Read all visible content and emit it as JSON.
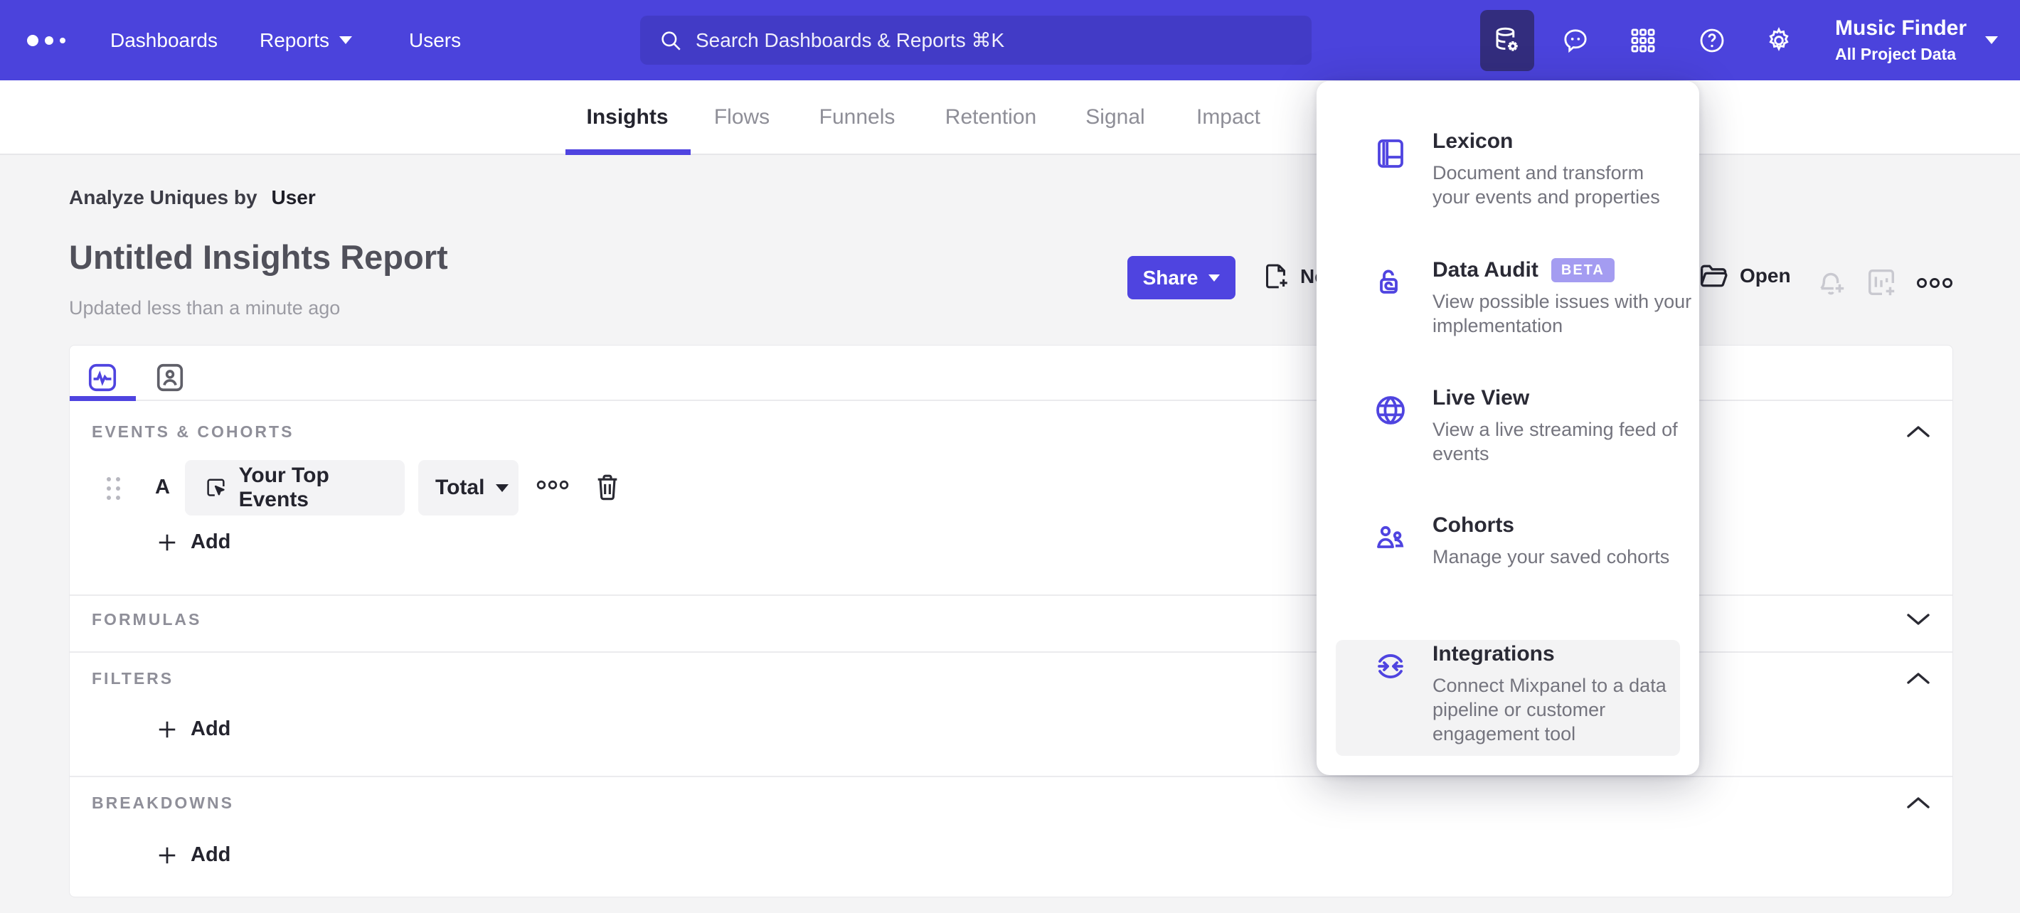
{
  "nav": {
    "items": [
      {
        "label": "Dashboards"
      },
      {
        "label": "Reports"
      },
      {
        "label": "Users"
      }
    ],
    "search_placeholder": "Search Dashboards & Reports ⌘K",
    "project": {
      "name": "Music Finder",
      "scope": "All Project Data"
    }
  },
  "tabs": {
    "items": [
      {
        "label": "Insights"
      },
      {
        "label": "Flows"
      },
      {
        "label": "Funnels"
      },
      {
        "label": "Retention"
      },
      {
        "label": "Signal"
      },
      {
        "label": "Impact"
      }
    ],
    "active": "Insights"
  },
  "report": {
    "analyze_prefix": "Analyze Uniques by",
    "analyze_value": "User",
    "title": "Untitled Insights Report",
    "updated": "Updated less than a minute ago",
    "actions": {
      "share": "Share",
      "new_partial": "Ne",
      "open": "Open"
    }
  },
  "builder": {
    "events": {
      "label": "EVENTS & COHORTS",
      "row_letter": "A",
      "event_name": "Your Top Events",
      "metric": "Total",
      "add_label": "Add"
    },
    "formulas": {
      "label": "FORMULAS"
    },
    "filters": {
      "label": "FILTERS",
      "add_label": "Add"
    },
    "breakdowns": {
      "label": "BREAKDOWNS",
      "add_label": "Add"
    }
  },
  "menu": {
    "items": [
      {
        "title": "Lexicon",
        "desc": "Document and transform your events and properties"
      },
      {
        "title": "Data Audit",
        "badge": "BETA",
        "desc": "View possible issues with your implementation"
      },
      {
        "title": "Live View",
        "desc": "View a live streaming feed of events"
      },
      {
        "title": "Cohorts",
        "desc": "Manage your saved cohorts"
      },
      {
        "title": "Integrations",
        "desc": "Connect Mixpanel to a data pipeline or customer engagement tool",
        "highlighted": true
      }
    ]
  },
  "colors": {
    "nav_bg": "#4b43dc",
    "nav_active_tile": "#332d7e",
    "search_bg": "#423bc6",
    "accent": "#4f44e0",
    "beta_badge": "#a49cf1",
    "page_bg": "#f4f4f5",
    "menu_highlight": "#f3f3f4",
    "text_dark": "#24242e",
    "text_grey": "#8f8f99"
  }
}
